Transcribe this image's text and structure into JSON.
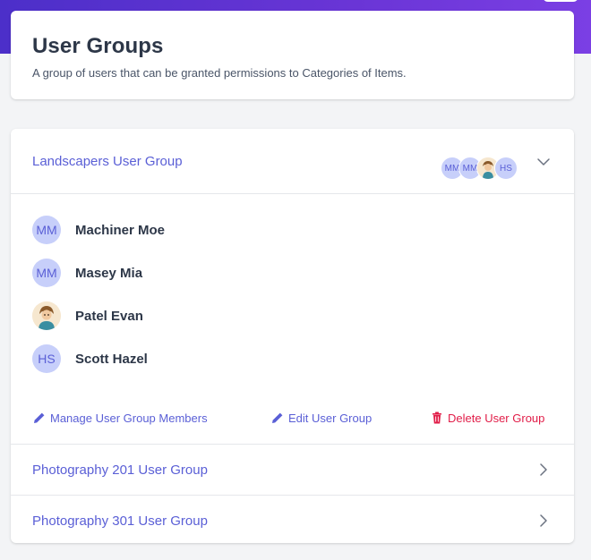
{
  "header": {
    "title": "User Groups",
    "subtitle": "A group of users that can be granted permissions to Categories of Items."
  },
  "groups": [
    {
      "name": "Landscapers User Group",
      "expanded": true,
      "avatar_stack": [
        "MM",
        "MM",
        "photo",
        "HS"
      ],
      "members": [
        {
          "initials": "MM",
          "name": "Machiner Moe",
          "avatar": "initials"
        },
        {
          "initials": "MM",
          "name": "Masey Mia",
          "avatar": "initials"
        },
        {
          "initials": "",
          "name": "Patel Evan",
          "avatar": "photo"
        },
        {
          "initials": "HS",
          "name": "Scott Hazel",
          "avatar": "initials"
        }
      ],
      "actions": {
        "manage_label": "Manage User Group Members",
        "edit_label": "Edit User Group",
        "delete_label": "Delete User Group"
      }
    },
    {
      "name": "Photography 201 User Group",
      "expanded": false
    },
    {
      "name": "Photography 301 User Group",
      "expanded": false
    }
  ],
  "colors": {
    "accent": "#5a5fd6",
    "danger": "#e11d48",
    "avatar_bg": "#c7cffa",
    "banner": "#5b33d0"
  },
  "icons": {
    "expanded_indicator": "chevron-down-icon",
    "collapsed_indicator": "chevron-right-icon",
    "manage": "pencil-icon",
    "edit": "pencil-icon",
    "delete": "trash-icon"
  }
}
